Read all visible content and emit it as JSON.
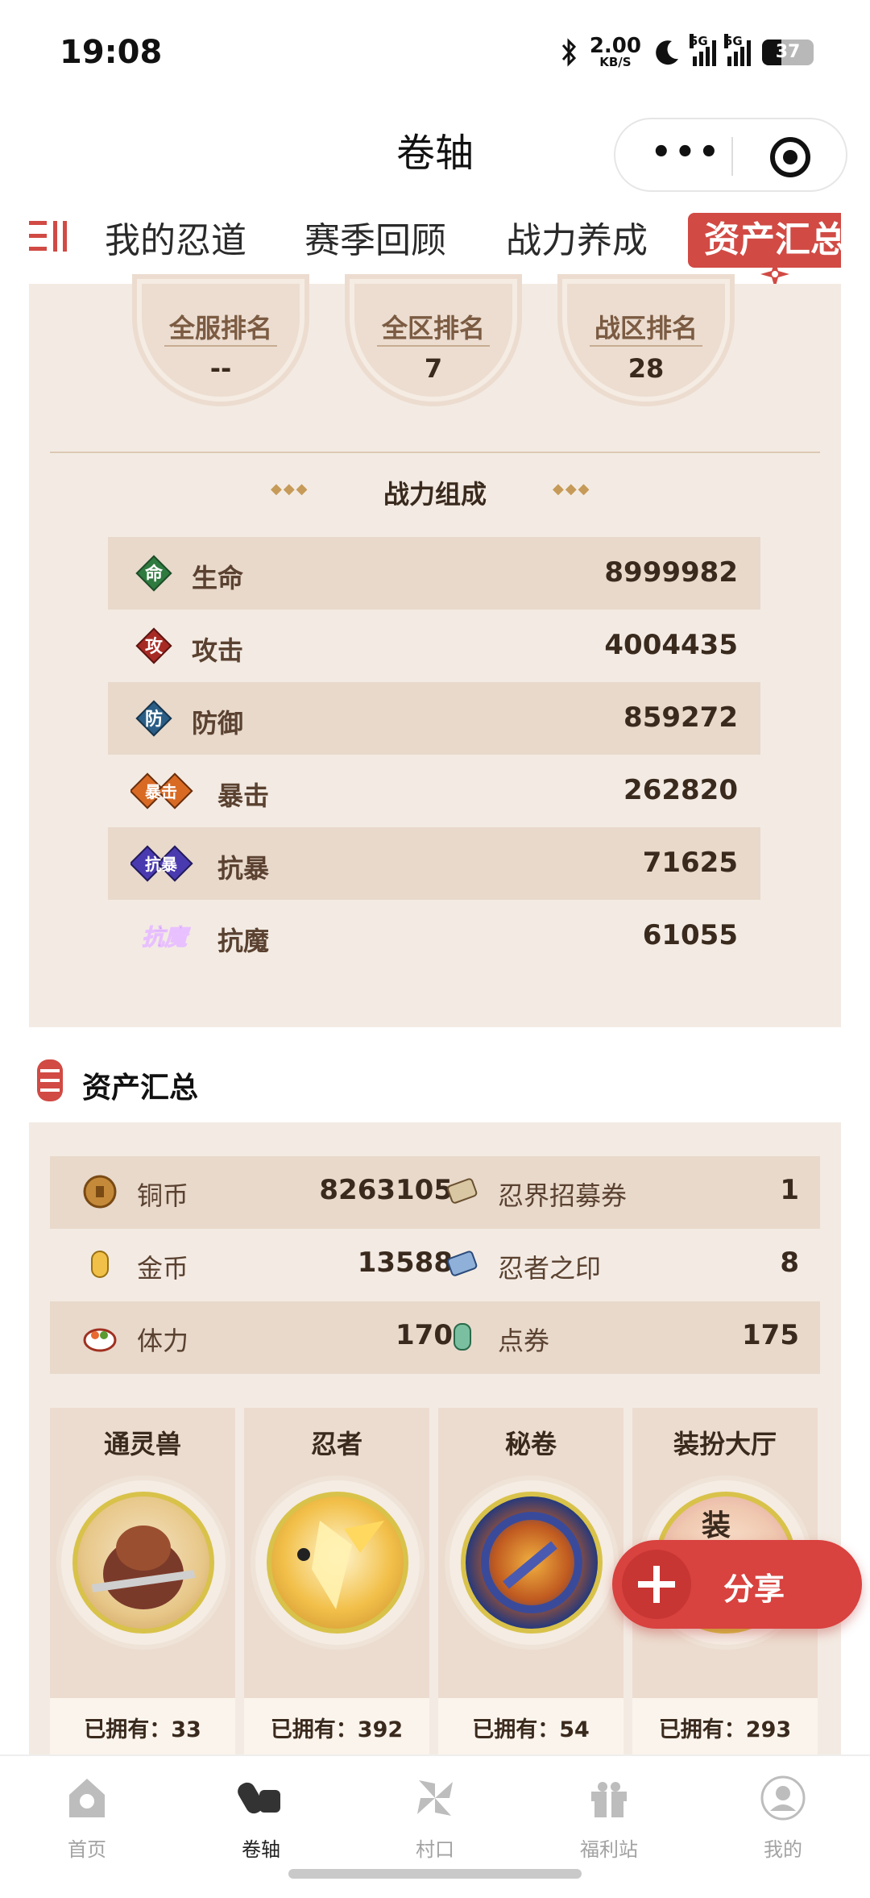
{
  "status_bar": {
    "time": "19:08",
    "net_speed_value": "2.00",
    "net_speed_unit": "KB/S",
    "sim1": "5G",
    "sim2": "5G",
    "battery": "37"
  },
  "title_bar": {
    "title": "卷轴",
    "more_label": "•••"
  },
  "tabs": {
    "items": [
      "我的忍道",
      "赛季回顾",
      "战力养成"
    ],
    "active": "资产汇总"
  },
  "ranking": [
    {
      "label": "全服排名",
      "value": "--"
    },
    {
      "label": "全区排名",
      "value": "7"
    },
    {
      "label": "战区排名",
      "value": "28"
    }
  ],
  "power": {
    "title": "战力组成",
    "diamonds": "◆◆◆",
    "stats": [
      {
        "name": "生命",
        "glyph": "命",
        "value": "8999982",
        "icon_color": "#2f7a3f"
      },
      {
        "name": "攻击",
        "glyph": "攻",
        "value": "4004435",
        "icon_color": "#a82a24"
      },
      {
        "name": "防御",
        "glyph": "防",
        "value": "859272",
        "icon_color": "#2a5e86"
      },
      {
        "name": "暴击",
        "glyph": "暴击",
        "value": "262820",
        "icon_color": "#d86a24"
      },
      {
        "name": "抗暴",
        "glyph": "抗暴",
        "value": "71625",
        "icon_color": "#4a3ab0"
      },
      {
        "name": "抗魔",
        "glyph": "抗魔",
        "value": "61055",
        "icon_color": "#7a2aa8"
      }
    ]
  },
  "assets": {
    "title": "资产汇总",
    "rows": [
      {
        "left_name": "铜币",
        "left_value": "8263105",
        "right_name": "忍界招募券",
        "right_value": "1"
      },
      {
        "left_name": "金币",
        "left_value": "13588",
        "right_name": "忍者之印",
        "right_value": "8"
      },
      {
        "left_name": "体力",
        "left_value": "170",
        "right_name": "点券",
        "right_value": "175"
      }
    ],
    "cards": [
      {
        "title": "通灵兽",
        "owned": "已拥有：33"
      },
      {
        "title": "忍者",
        "owned": "已拥有：392"
      },
      {
        "title": "秘卷",
        "owned": "已拥有：54"
      },
      {
        "title": "装扮大厅",
        "owned": "已拥有：293"
      }
    ],
    "card_badge": "装"
  },
  "share": {
    "label": "分享"
  },
  "bottom_nav": [
    {
      "label": "首页"
    },
    {
      "label": "卷轴"
    },
    {
      "label": "村口"
    },
    {
      "label": "福利站"
    },
    {
      "label": "我的"
    }
  ]
}
